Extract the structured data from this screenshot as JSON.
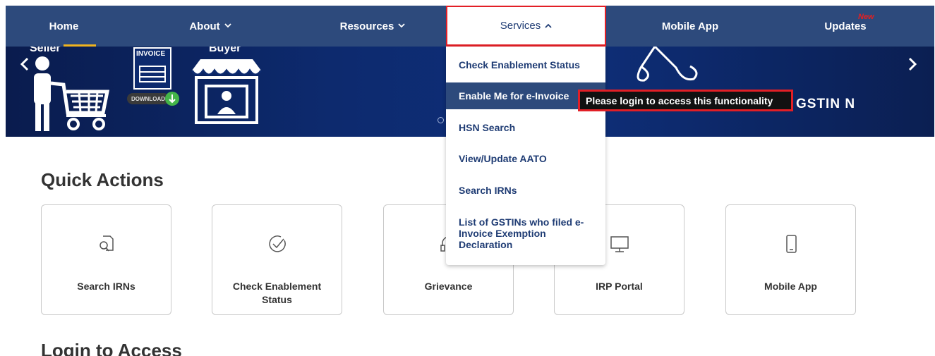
{
  "nav": {
    "items": [
      {
        "label": "Home"
      },
      {
        "label": "About"
      },
      {
        "label": "Resources"
      },
      {
        "label": "Services"
      },
      {
        "label": "Mobile App"
      },
      {
        "label": "Updates"
      }
    ],
    "new_badge": "New"
  },
  "hero": {
    "seller_label": "Seller",
    "buyer_label": "Buyer",
    "invoice_label": "INVOICE",
    "download_label": "DOWNLOAD",
    "gstin_text": "GSTIN N"
  },
  "services_menu": {
    "items": [
      {
        "label": "Check Enablement Status"
      },
      {
        "label": "Enable Me for e-Invoice"
      },
      {
        "label": "HSN Search"
      },
      {
        "label": "View/Update AATO"
      },
      {
        "label": "Search IRNs"
      },
      {
        "label": "List of GSTINs who filed e-Invoice Exemption Declaration"
      }
    ]
  },
  "tooltip": {
    "text": "Please login to access this functionality"
  },
  "quick_actions": {
    "title": "Quick Actions",
    "cards": [
      {
        "label": "Search IRNs",
        "icon": "search-document-icon"
      },
      {
        "label": "Check Enablement Status",
        "icon": "check-circle-icon"
      },
      {
        "label": "Grievance",
        "icon": "headset-icon"
      },
      {
        "label": "IRP Portal",
        "icon": "monitor-icon"
      },
      {
        "label": "Mobile App",
        "icon": "mobile-phone-icon"
      }
    ]
  },
  "login_section": {
    "title": "Login to Access"
  },
  "colors": {
    "nav_bg": "#2d4a7c",
    "accent_red": "#e21f26",
    "home_underline": "#f0b41f",
    "menu_text": "#1f3c74"
  }
}
